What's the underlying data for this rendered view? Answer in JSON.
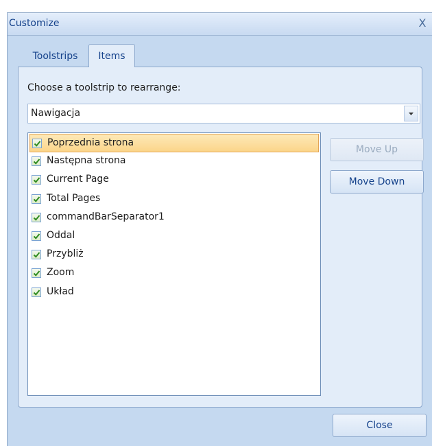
{
  "window": {
    "title": "Customize",
    "close_glyph": "X"
  },
  "tabs": [
    {
      "label": "Toolstrips",
      "active": false
    },
    {
      "label": "Items",
      "active": true
    }
  ],
  "panel": {
    "choose_label": "Choose a toolstrip to rearrange:",
    "toolstrip_select": {
      "value": "Nawigacja"
    },
    "items": [
      {
        "label": "Poprzednia strona",
        "checked": true,
        "selected": true
      },
      {
        "label": "Następna strona",
        "checked": true,
        "selected": false
      },
      {
        "label": "Current Page",
        "checked": true,
        "selected": false
      },
      {
        "label": "Total Pages",
        "checked": true,
        "selected": false
      },
      {
        "label": "commandBarSeparator1",
        "checked": true,
        "selected": false
      },
      {
        "label": "Oddal",
        "checked": true,
        "selected": false
      },
      {
        "label": "Przybliż",
        "checked": true,
        "selected": false
      },
      {
        "label": "Zoom",
        "checked": true,
        "selected": false
      },
      {
        "label": "Układ",
        "checked": true,
        "selected": false
      }
    ],
    "buttons": {
      "move_up": {
        "label": "Move Up",
        "enabled": false
      },
      "move_down": {
        "label": "Move Down",
        "enabled": true
      }
    }
  },
  "footer": {
    "close_label": "Close"
  },
  "colors": {
    "window_bg": "#c5d9f0",
    "title_text": "#15428b",
    "selection_bg": "#fbd58a",
    "selection_border": "#e2a455",
    "check_green": "#2e8b1f"
  },
  "icons": {
    "checkbox": "checkmark-icon",
    "dropdown": "chevron-down-icon",
    "close": "close-icon"
  }
}
